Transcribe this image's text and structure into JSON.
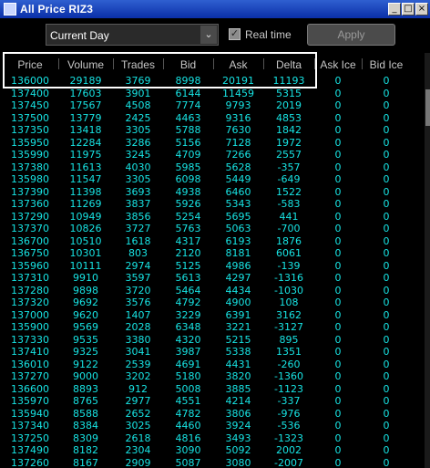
{
  "window": {
    "title": "All Price RIZ3"
  },
  "toolbar": {
    "period": "Current Day",
    "realtime_label": "Real time",
    "realtime_checked": "✓",
    "apply_label": "Apply"
  },
  "columns": [
    "Price",
    "Volume",
    "Trades",
    "Bid",
    "Ask",
    "Delta",
    "Ask Ice",
    "Bid Ice"
  ],
  "rows": [
    [
      "136000",
      "29189",
      "3769",
      "8998",
      "20191",
      "11193",
      "0",
      "0"
    ],
    [
      "137400",
      "17603",
      "3901",
      "6144",
      "11459",
      "5315",
      "0",
      "0"
    ],
    [
      "137450",
      "17567",
      "4508",
      "7774",
      "9793",
      "2019",
      "0",
      "0"
    ],
    [
      "137500",
      "13779",
      "2425",
      "4463",
      "9316",
      "4853",
      "0",
      "0"
    ],
    [
      "137350",
      "13418",
      "3305",
      "5788",
      "7630",
      "1842",
      "0",
      "0"
    ],
    [
      "135950",
      "12284",
      "3286",
      "5156",
      "7128",
      "1972",
      "0",
      "0"
    ],
    [
      "135990",
      "11975",
      "3245",
      "4709",
      "7266",
      "2557",
      "0",
      "0"
    ],
    [
      "137380",
      "11613",
      "4030",
      "5985",
      "5628",
      "-357",
      "0",
      "0"
    ],
    [
      "135980",
      "11547",
      "3305",
      "6098",
      "5449",
      "-649",
      "0",
      "0"
    ],
    [
      "137390",
      "11398",
      "3693",
      "4938",
      "6460",
      "1522",
      "0",
      "0"
    ],
    [
      "137360",
      "11269",
      "3837",
      "5926",
      "5343",
      "-583",
      "0",
      "0"
    ],
    [
      "137290",
      "10949",
      "3856",
      "5254",
      "5695",
      "441",
      "0",
      "0"
    ],
    [
      "137370",
      "10826",
      "3727",
      "5763",
      "5063",
      "-700",
      "0",
      "0"
    ],
    [
      "136700",
      "10510",
      "1618",
      "4317",
      "6193",
      "1876",
      "0",
      "0"
    ],
    [
      "136750",
      "10301",
      "803",
      "2120",
      "8181",
      "6061",
      "0",
      "0"
    ],
    [
      "135960",
      "10111",
      "2974",
      "5125",
      "4986",
      "-139",
      "0",
      "0"
    ],
    [
      "137310",
      "9910",
      "3597",
      "5613",
      "4297",
      "-1316",
      "0",
      "0"
    ],
    [
      "137280",
      "9898",
      "3720",
      "5464",
      "4434",
      "-1030",
      "0",
      "0"
    ],
    [
      "137320",
      "9692",
      "3576",
      "4792",
      "4900",
      "108",
      "0",
      "0"
    ],
    [
      "137000",
      "9620",
      "1407",
      "3229",
      "6391",
      "3162",
      "0",
      "0"
    ],
    [
      "135900",
      "9569",
      "2028",
      "6348",
      "3221",
      "-3127",
      "0",
      "0"
    ],
    [
      "137330",
      "9535",
      "3380",
      "4320",
      "5215",
      "895",
      "0",
      "0"
    ],
    [
      "137410",
      "9325",
      "3041",
      "3987",
      "5338",
      "1351",
      "0",
      "0"
    ],
    [
      "136010",
      "9122",
      "2539",
      "4691",
      "4431",
      "-260",
      "0",
      "0"
    ],
    [
      "137270",
      "9000",
      "3202",
      "5180",
      "3820",
      "-1360",
      "0",
      "0"
    ],
    [
      "136600",
      "8893",
      "912",
      "5008",
      "3885",
      "-1123",
      "0",
      "0"
    ],
    [
      "135970",
      "8765",
      "2977",
      "4551",
      "4214",
      "-337",
      "0",
      "0"
    ],
    [
      "135940",
      "8588",
      "2652",
      "4782",
      "3806",
      "-976",
      "0",
      "0"
    ],
    [
      "137340",
      "8384",
      "3025",
      "4460",
      "3924",
      "-536",
      "0",
      "0"
    ],
    [
      "137250",
      "8309",
      "2618",
      "4816",
      "3493",
      "-1323",
      "0",
      "0"
    ],
    [
      "137490",
      "8182",
      "2304",
      "3090",
      "5092",
      "2002",
      "0",
      "0"
    ],
    [
      "137260",
      "8167",
      "2909",
      "5087",
      "3080",
      "-2007",
      "0",
      "0"
    ]
  ],
  "colors": {
    "value_text": "#17e3e3",
    "header_text": "#c6c6c6",
    "background": "#000000"
  }
}
